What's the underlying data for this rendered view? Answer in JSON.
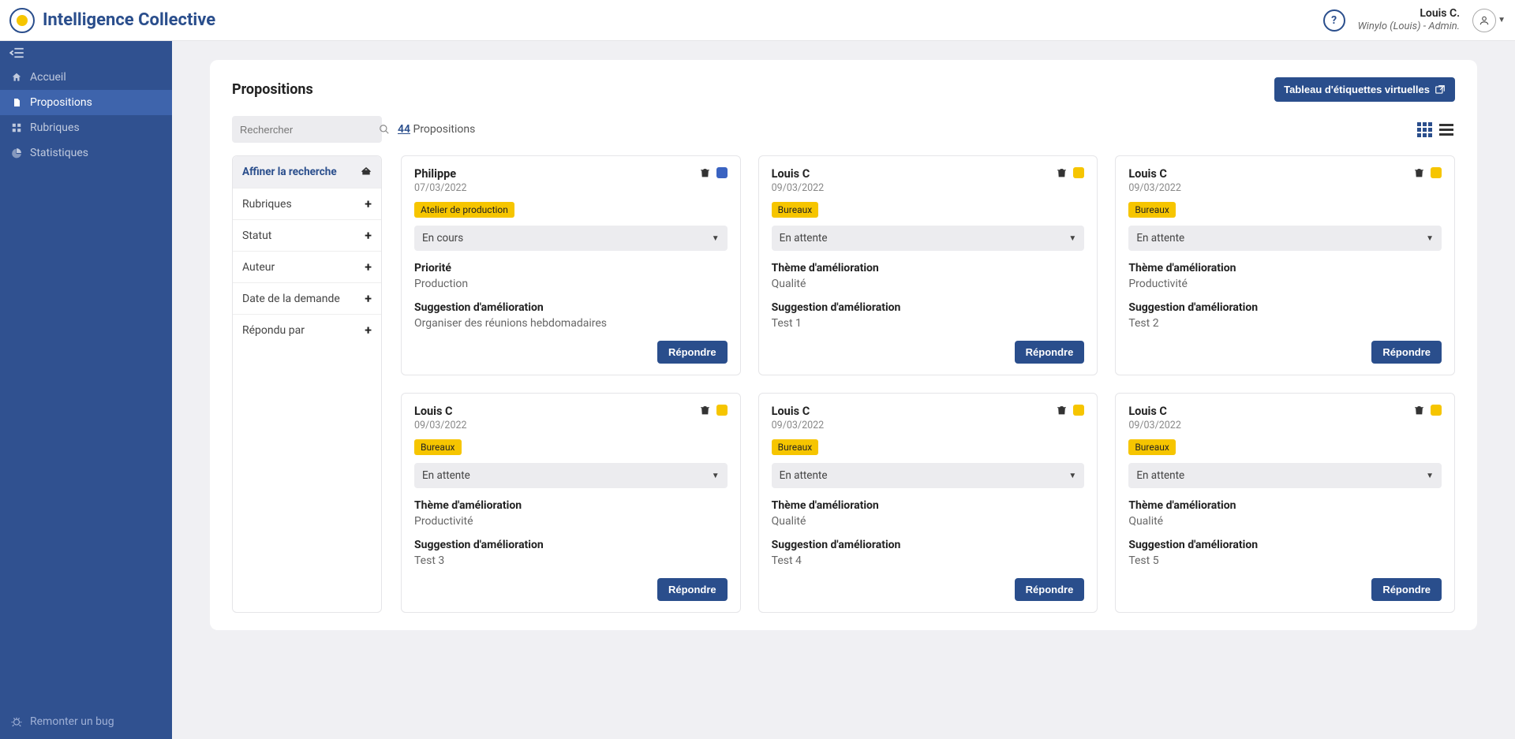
{
  "brand": "Intelligence Collective",
  "user": {
    "name": "Louis C.",
    "sub": "Winylo (Louis) - Admin."
  },
  "sidebar": {
    "items": [
      {
        "label": "Accueil",
        "icon": "home"
      },
      {
        "label": "Propositions",
        "icon": "file",
        "active": true
      },
      {
        "label": "Rubriques",
        "icon": "grid"
      },
      {
        "label": "Statistiques",
        "icon": "pie"
      }
    ],
    "footer": "Remonter un bug"
  },
  "page": {
    "title": "Propositions",
    "board_btn": "Tableau d'étiquettes virtuelles",
    "search_placeholder": "Rechercher",
    "count": "44",
    "count_label": "Propositions",
    "respond": "Répondre"
  },
  "filters": {
    "title": "Affiner la recherche",
    "rows": [
      "Rubriques",
      "Statut",
      "Auteur",
      "Date de la demande",
      "Répondu par"
    ]
  },
  "labels": {
    "priority": "Priorité",
    "theme": "Thème d'amélioration",
    "suggestion": "Suggestion d'amélioration"
  },
  "cards": [
    {
      "author": "Philippe",
      "date": "07/03/2022",
      "chip": "blue",
      "tag": "Atelier de production",
      "status": "En cours",
      "f1label": "priority",
      "f1value": "Production",
      "f2value": "Organiser des réunions hebdomadaires"
    },
    {
      "author": "Louis C",
      "date": "09/03/2022",
      "chip": "yellow",
      "tag": "Bureaux",
      "status": "En attente",
      "f1label": "theme",
      "f1value": "Qualité",
      "f2value": "Test 1"
    },
    {
      "author": "Louis C",
      "date": "09/03/2022",
      "chip": "yellow",
      "tag": "Bureaux",
      "status": "En attente",
      "f1label": "theme",
      "f1value": "Productivité",
      "f2value": "Test 2"
    },
    {
      "author": "Louis C",
      "date": "09/03/2022",
      "chip": "yellow",
      "tag": "Bureaux",
      "status": "En attente",
      "f1label": "theme",
      "f1value": "Productivité",
      "f2value": "Test 3"
    },
    {
      "author": "Louis C",
      "date": "09/03/2022",
      "chip": "yellow",
      "tag": "Bureaux",
      "status": "En attente",
      "f1label": "theme",
      "f1value": "Qualité",
      "f2value": "Test 4"
    },
    {
      "author": "Louis C",
      "date": "09/03/2022",
      "chip": "yellow",
      "tag": "Bureaux",
      "status": "En attente",
      "f1label": "theme",
      "f1value": "Qualité",
      "f2value": "Test 5"
    }
  ]
}
